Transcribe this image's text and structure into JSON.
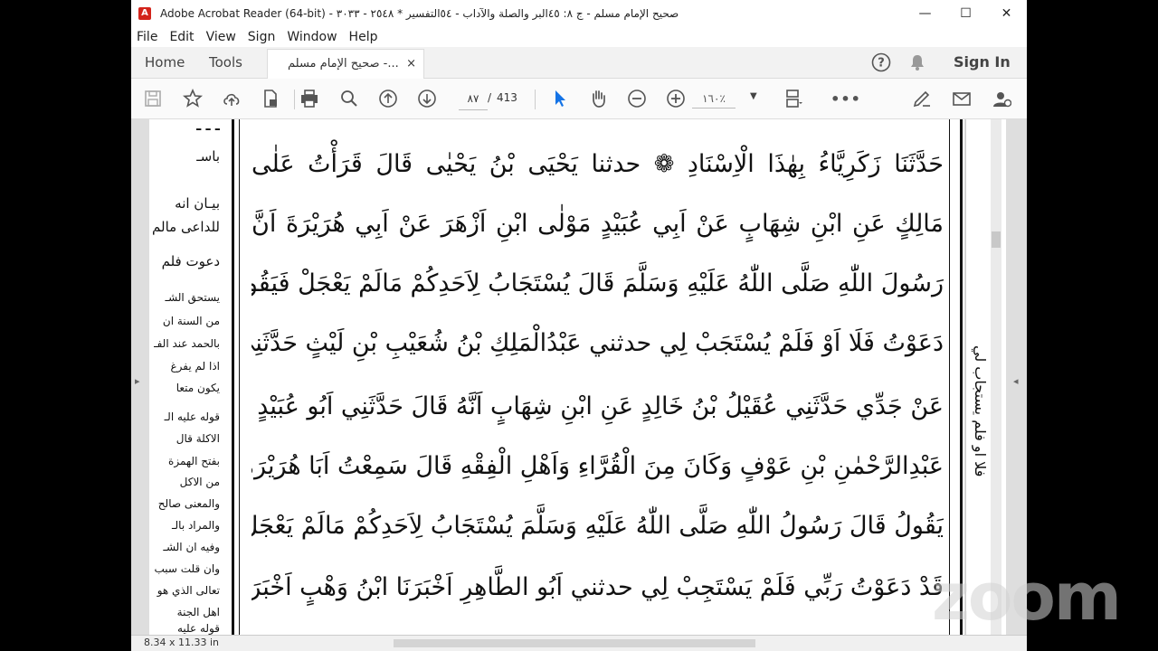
{
  "window": {
    "title": "صحيح الإمام مسلم - ج ٨: ٤٥البر والصلة والآداب - ٥٤التفسير * ٢٥٤٨ - ٣٠٣٣ - Adobe Acrobat Reader (64-bit)",
    "app_icon": "acrobat-icon",
    "controls": {
      "minimize": "—",
      "maximize": "☐",
      "close": "✕"
    }
  },
  "menu": [
    "File",
    "Edit",
    "View",
    "Sign",
    "Window",
    "Help"
  ],
  "tabs": {
    "home": "Home",
    "tools": "Tools",
    "document": "صحيح الإمام مسلم -...",
    "close": "×"
  },
  "header_right": {
    "help_icon": "help-icon",
    "bell_icon": "notification-bell-icon",
    "sign_in": "Sign In"
  },
  "toolbar": {
    "page_current": "٨٧",
    "page_sep": "/",
    "page_total": "413",
    "zoom": "١٦٠٪",
    "zoom_dropdown": "▼",
    "more": "•••"
  },
  "document": {
    "main_lines": [
      "حَدَّثَنَا زَكَرِيَّاءُ بِهٰذَا الْاِسْنَادِ ❁ حدثنا يَحْيَى بْنُ يَحْيٰى قَالَ قَرَأْتُ عَلٰى",
      "مَالِكٍ عَنِ ابْنِ شِهَابٍ عَنْ اَبِي عُبَيْدٍ مَوْلٰى ابْنِ اَزْهَرَ عَنْ اَبِي هُرَيْرَةَ اَنَّ",
      "رَسُولَ اللّٰهِ صَلَّى اللّٰهُ عَلَيْهِ وَسَلَّمَ قَالَ يُسْتَجَابُ لِاَحَدِكُمْ مَالَمْ يَعْجَلْ فَيَقُولُ قَدْ",
      "دَعَوْتُ فَلَا اَوْ فَلَمْ يُسْتَجَبْ لِي حدثني عَبْدُالْمَلِكِ بْنُ شُعَيْبِ بْنِ لَيْثٍ حَدَّثَنِي اَبِي",
      "عَنْ جَدِّي حَدَّثَنِي عُقَيْلُ بْنُ خَالِدٍ عَنِ ابْنِ شِهَابٍ اَنَّهُ قَالَ حَدَّثَنِي اَبُو عُبَيْدٍ مَوْلٰى",
      "عَبْدِالرَّحْمٰنِ بْنِ عَوْفٍ وَكَانَ مِنَ الْقُرَّاءِ وَاَهْلِ الْفِقْهِ قَالَ سَمِعْتُ اَبَا هُرَيْرَةَ",
      "يَقُولُ قَالَ رَسُولُ اللّٰهِ صَلَّى اللّٰهُ عَلَيْهِ وَسَلَّمَ يُسْتَجَابُ لِاَحَدِكُمْ مَالَمْ يَعْجَلْ فَيَقُولُ",
      "قَدْ دَعَوْتُ رَبِّي فَلَمْ يَسْتَجِبْ لِي حدثني اَبُو الطَّاهِرِ اَخْبَرَنَا ابْنُ وَهْبٍ اَخْبَرَنِي"
    ],
    "margin_notes": [
      "باسـ",
      "بيـان انه",
      "للداعى مالم",
      "دعوت فلم",
      "يستحق الشـ",
      "من السنة ان",
      "بالحمد عند الفـ",
      "اذا لم يفرغ",
      "يكون متعا",
      "قوله عليه الـ",
      "الاكلة قال",
      "بفتح الهمزة",
      "من الاكل",
      "والمعنى صالح",
      "والمراد بالـ",
      "وفيه ان الشـ",
      "وان قلت سبب",
      "تعالى الذي هو",
      "اهل الجنة",
      "قوله عليه"
    ],
    "right_margin": "فلا او فلم يستجاب لي"
  },
  "status": {
    "page_size": "8.34 x 11.33 in"
  },
  "watermark": "zoom"
}
